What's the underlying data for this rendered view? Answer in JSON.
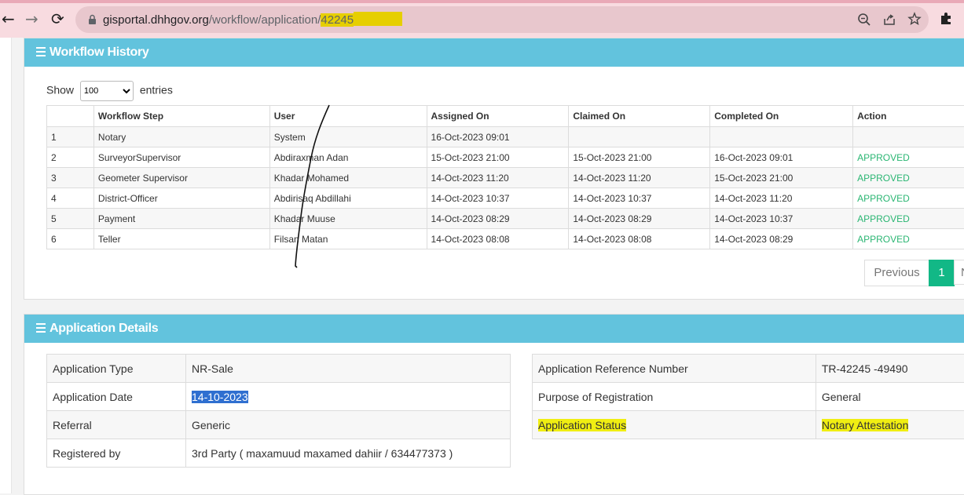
{
  "browser": {
    "url_host": "gisportal.dhhgov.org",
    "url_path": "/workflow/application/",
    "url_id": "42245"
  },
  "workflow": {
    "title": "Workflow History",
    "show_label": "Show",
    "entries_select": "100",
    "entries_label": "entries",
    "columns": [
      "",
      "Workflow Step",
      "User",
      "Assigned On",
      "Claimed On",
      "Completed On",
      "Action"
    ],
    "rows": [
      [
        "1",
        "Notary",
        "System",
        "16-Oct-2023 09:01",
        "",
        "",
        ""
      ],
      [
        "2",
        "SurveyorSupervisor",
        "Abdiraxman Adan",
        "15-Oct-2023 21:00",
        "15-Oct-2023 21:00",
        "16-Oct-2023 09:01",
        "APPROVED"
      ],
      [
        "3",
        "Geometer Supervisor",
        "Khadar Mohamed",
        "14-Oct-2023 11:20",
        "14-Oct-2023 11:20",
        "15-Oct-2023 21:00",
        "APPROVED"
      ],
      [
        "4",
        "District-Officer",
        "Abdirisaq Abdillahi",
        "14-Oct-2023 10:37",
        "14-Oct-2023 10:37",
        "14-Oct-2023 11:20",
        "APPROVED"
      ],
      [
        "5",
        "Payment",
        "Khadar Muuse",
        "14-Oct-2023 08:29",
        "14-Oct-2023 08:29",
        "14-Oct-2023 10:37",
        "APPROVED"
      ],
      [
        "6",
        "Teller",
        "Filsan Matan",
        "14-Oct-2023 08:08",
        "14-Oct-2023 08:08",
        "14-Oct-2023 08:29",
        "APPROVED"
      ]
    ],
    "pager": {
      "previous": "Previous",
      "current": "1",
      "next": "N"
    }
  },
  "details": {
    "title": "Application Details",
    "left": [
      {
        "label": "Application Type",
        "value": "NR-Sale"
      },
      {
        "label": "Application Date",
        "value": "14-10-2023"
      },
      {
        "label": "Referral",
        "value": "Generic"
      },
      {
        "label": "Registered by",
        "value": "3rd Party ( maxamuud maxamed dahiir / 634477373 )"
      }
    ],
    "right": [
      {
        "label": "Application Reference Number",
        "value": "TR-42245 -49490"
      },
      {
        "label": "Purpose of Registration",
        "value": "General"
      },
      {
        "label": "Application Status",
        "value": "Notary Attestation"
      }
    ]
  },
  "colors": {
    "panel_header": "#62c3dd",
    "approved": "#2bb673",
    "pager_active": "#12b886",
    "highlight": "#f0ee12",
    "selection": "#2f6fd0"
  }
}
